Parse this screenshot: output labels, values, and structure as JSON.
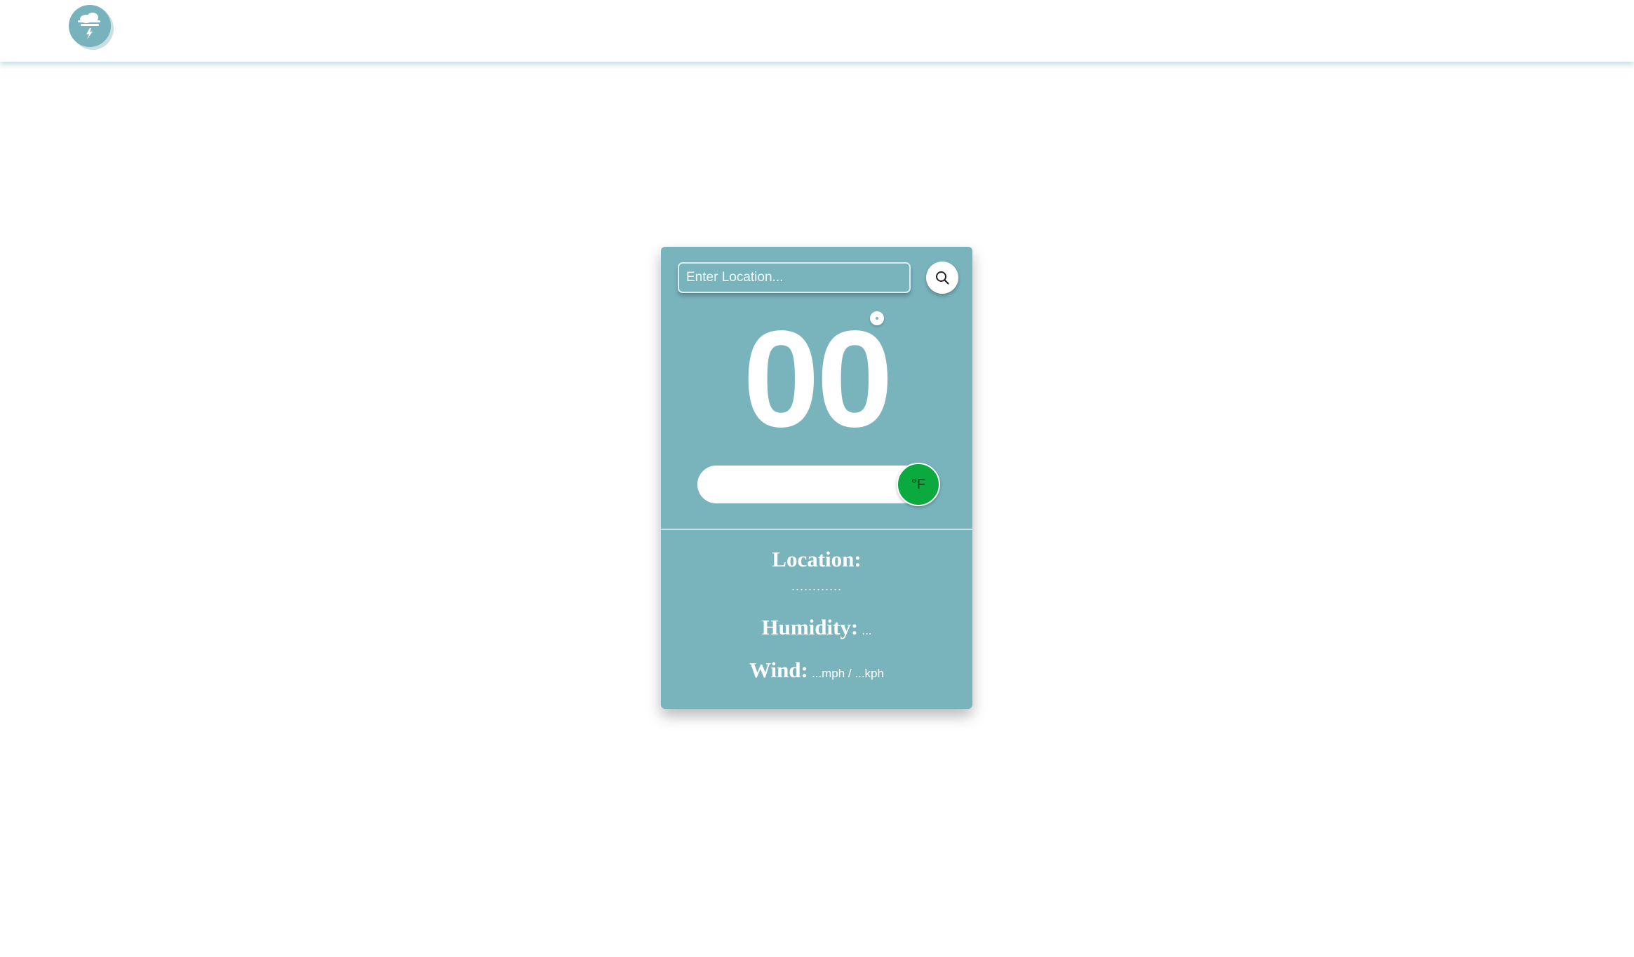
{
  "header": {
    "logo_icon": "cloud-lightning-icon"
  },
  "search": {
    "placeholder": "Enter Location...",
    "button_icon": "search-icon"
  },
  "temperature": {
    "value": "00"
  },
  "unit_toggle": {
    "label": "°F",
    "active_color": "#0aaa3e"
  },
  "details": {
    "location_label": "Location:",
    "location_value": "............",
    "humidity_label": "Humidity:",
    "humidity_value": "...",
    "wind_label": "Wind:",
    "wind_value": "...mph / ...kph"
  },
  "colors": {
    "card": "#79b4bd",
    "accent_toggle": "#0aaa3e"
  }
}
